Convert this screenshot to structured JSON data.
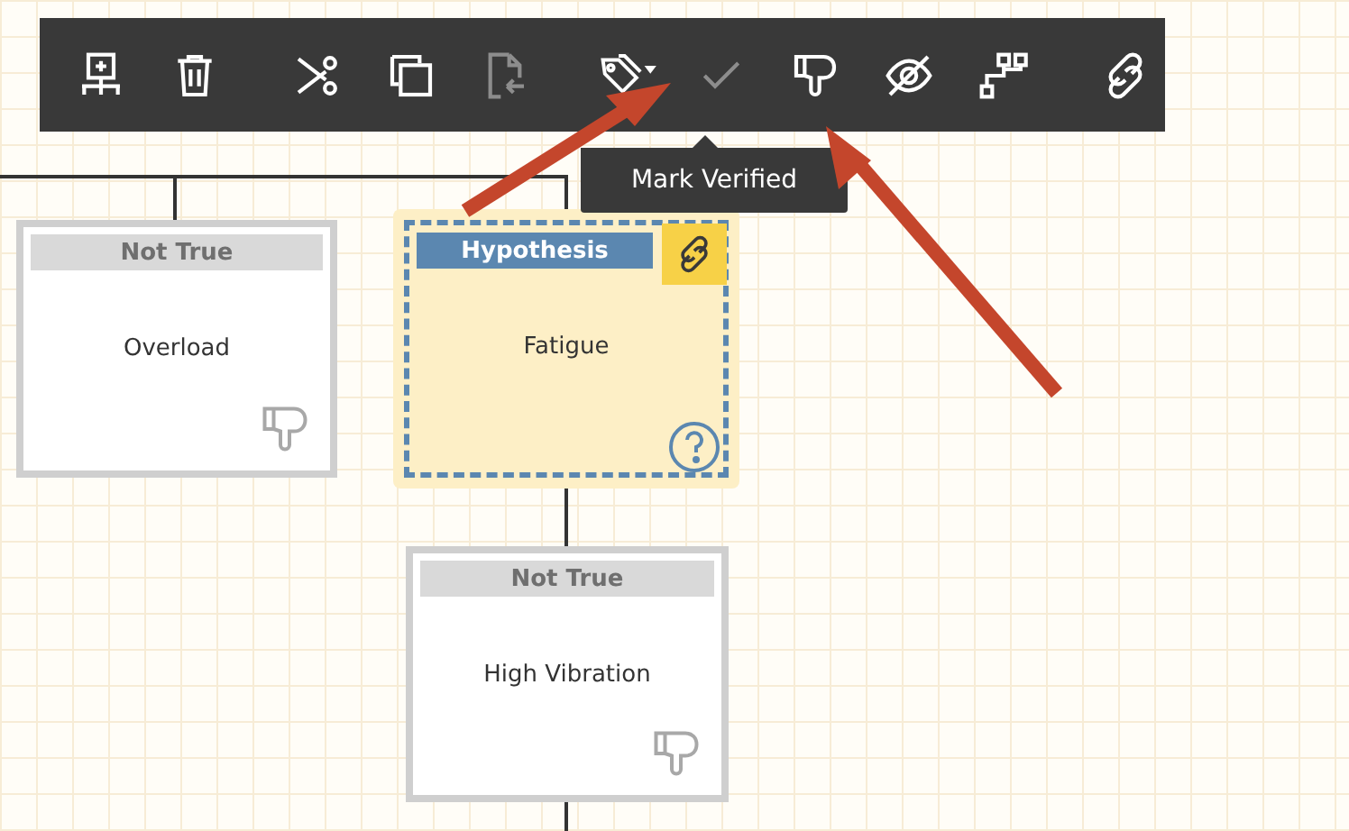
{
  "toolbar": {
    "groups": [
      [
        {
          "kind": "add-child",
          "disabled": false
        },
        {
          "kind": "delete",
          "disabled": false
        }
      ],
      [
        {
          "kind": "cut",
          "disabled": false
        },
        {
          "kind": "copy",
          "disabled": false
        },
        {
          "kind": "paste",
          "disabled": true
        }
      ],
      [
        {
          "kind": "tag",
          "disabled": false
        },
        {
          "kind": "verify",
          "disabled": true
        },
        {
          "kind": "reject",
          "disabled": false
        },
        {
          "kind": "hide",
          "disabled": false
        },
        {
          "kind": "hierarchy",
          "disabled": false
        }
      ],
      [
        {
          "kind": "link",
          "disabled": false
        }
      ]
    ]
  },
  "tooltip": {
    "text": "Mark Verified"
  },
  "nodes": [
    {
      "kind": "not_true",
      "status": "Not True",
      "title": "Overload",
      "selected": false,
      "linked": false
    },
    {
      "kind": "hypothesis",
      "status": "Hypothesis",
      "title": "Fatigue",
      "selected": true,
      "linked": true
    },
    {
      "kind": "not_true",
      "status": "Not True",
      "title": "High Vibration",
      "selected": false,
      "linked": false
    }
  ]
}
